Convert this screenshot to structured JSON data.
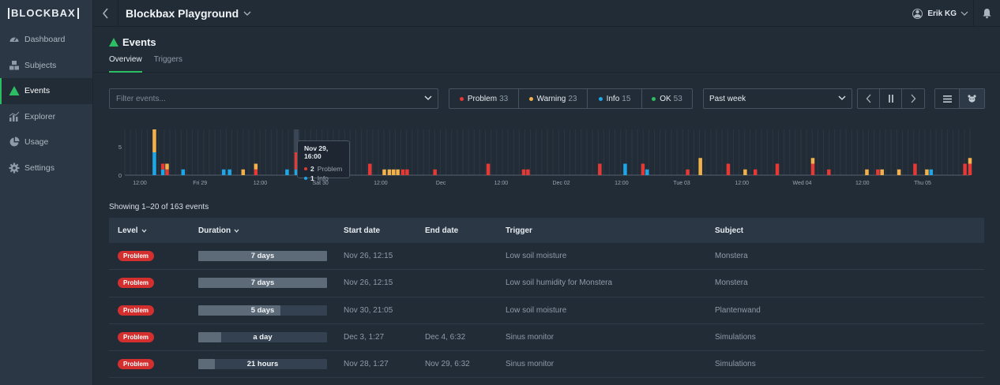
{
  "app": {
    "logo_text": "BLOCKBAX"
  },
  "sidebar": {
    "items": [
      {
        "label": "Dashboard",
        "icon": "gauge-icon"
      },
      {
        "label": "Subjects",
        "icon": "cubes-icon"
      },
      {
        "label": "Events",
        "icon": "warning-triangle-icon",
        "active": true
      },
      {
        "label": "Explorer",
        "icon": "bar-chart-icon"
      },
      {
        "label": "Usage",
        "icon": "pie-chart-icon"
      },
      {
        "label": "Settings",
        "icon": "gear-icon"
      }
    ]
  },
  "topbar": {
    "workspace": "Blockbax Playground",
    "user": "Erik KG"
  },
  "page": {
    "title": "Events",
    "tabs": [
      {
        "label": "Overview",
        "active": true
      },
      {
        "label": "Triggers",
        "active": false
      }
    ]
  },
  "filters": {
    "search_placeholder": "Filter events...",
    "levels": [
      {
        "label": "Problem",
        "count": "33",
        "color": "#e53935"
      },
      {
        "label": "Warning",
        "count": "23",
        "color": "#f2b14a"
      },
      {
        "label": "Info",
        "count": "15",
        "color": "#1da7e8"
      },
      {
        "label": "OK",
        "count": "53",
        "color": "#2dbd63"
      }
    ],
    "range": "Past week"
  },
  "chart_data": {
    "type": "bar",
    "stacked": true,
    "yticks": [
      "0",
      "5"
    ],
    "ylim": [
      0,
      8
    ],
    "xticks": [
      "12:00",
      "Fri 29",
      "12:00",
      "Sat 30",
      "12:00",
      "Dec",
      "12:00",
      "Dec 02",
      "12:00",
      "Tue 03",
      "12:00",
      "Wed 04",
      "12:00",
      "Thu 05"
    ],
    "grid": true,
    "bars": [
      {
        "x": 0.035,
        "problem": 0,
        "warning": 4,
        "info": 4
      },
      {
        "x": 0.045,
        "problem": 1,
        "warning": 0,
        "info": 1
      },
      {
        "x": 0.05,
        "problem": 1,
        "warning": 1,
        "info": 0
      },
      {
        "x": 0.069,
        "problem": 0,
        "warning": 0,
        "info": 1
      },
      {
        "x": 0.117,
        "problem": 0,
        "warning": 0,
        "info": 1
      },
      {
        "x": 0.124,
        "problem": 0,
        "warning": 0,
        "info": 1
      },
      {
        "x": 0.14,
        "problem": 0,
        "warning": 1,
        "info": 0
      },
      {
        "x": 0.155,
        "problem": 1,
        "warning": 1,
        "info": 0
      },
      {
        "x": 0.192,
        "problem": 0,
        "warning": 0,
        "info": 1
      },
      {
        "x": 0.203,
        "problem": 3,
        "warning": 0,
        "info": 1
      },
      {
        "x": 0.223,
        "problem": 1,
        "warning": 0,
        "info": 1
      },
      {
        "x": 0.29,
        "problem": 2,
        "warning": 0,
        "info": 0
      },
      {
        "x": 0.307,
        "problem": 0,
        "warning": 1,
        "info": 0
      },
      {
        "x": 0.313,
        "problem": 0,
        "warning": 1,
        "info": 0
      },
      {
        "x": 0.318,
        "problem": 0,
        "warning": 1,
        "info": 0
      },
      {
        "x": 0.323,
        "problem": 0,
        "warning": 1,
        "info": 0
      },
      {
        "x": 0.329,
        "problem": 1,
        "warning": 0,
        "info": 0
      },
      {
        "x": 0.334,
        "problem": 1,
        "warning": 0,
        "info": 0
      },
      {
        "x": 0.367,
        "problem": 1,
        "warning": 0,
        "info": 0
      },
      {
        "x": 0.43,
        "problem": 2,
        "warning": 0,
        "info": 0
      },
      {
        "x": 0.472,
        "problem": 1,
        "warning": 0,
        "info": 0
      },
      {
        "x": 0.477,
        "problem": 1,
        "warning": 0,
        "info": 0
      },
      {
        "x": 0.562,
        "problem": 2,
        "warning": 0,
        "info": 0
      },
      {
        "x": 0.592,
        "problem": 0,
        "warning": 0,
        "info": 2
      },
      {
        "x": 0.613,
        "problem": 2,
        "warning": 0,
        "info": 0
      },
      {
        "x": 0.618,
        "problem": 0,
        "warning": 0,
        "info": 1
      },
      {
        "x": 0.666,
        "problem": 1,
        "warning": 0,
        "info": 0
      },
      {
        "x": 0.681,
        "problem": 0,
        "warning": 3,
        "info": 0
      },
      {
        "x": 0.714,
        "problem": 2,
        "warning": 0,
        "info": 0
      },
      {
        "x": 0.734,
        "problem": 0,
        "warning": 1,
        "info": 0
      },
      {
        "x": 0.746,
        "problem": 1,
        "warning": 0,
        "info": 0
      },
      {
        "x": 0.772,
        "problem": 2,
        "warning": 0,
        "info": 0
      },
      {
        "x": 0.814,
        "problem": 2,
        "warning": 1,
        "info": 0
      },
      {
        "x": 0.833,
        "problem": 1,
        "warning": 0,
        "info": 0
      },
      {
        "x": 0.878,
        "problem": 0,
        "warning": 1,
        "info": 0
      },
      {
        "x": 0.891,
        "problem": 1,
        "warning": 0,
        "info": 0
      },
      {
        "x": 0.896,
        "problem": 0,
        "warning": 1,
        "info": 0
      },
      {
        "x": 0.916,
        "problem": 0,
        "warning": 1,
        "info": 0
      },
      {
        "x": 0.935,
        "problem": 2,
        "warning": 0,
        "info": 0
      },
      {
        "x": 0.949,
        "problem": 0,
        "warning": 1,
        "info": 0
      },
      {
        "x": 0.954,
        "problem": 0,
        "warning": 0,
        "info": 1
      },
      {
        "x": 0.994,
        "problem": 2,
        "warning": 0,
        "info": 0
      },
      {
        "x": 1.0,
        "problem": 2,
        "warning": 1,
        "info": 0
      }
    ]
  },
  "tooltip": {
    "title": "Nov 29, 16:00",
    "rows": [
      {
        "count": "2",
        "label": "Problem",
        "color": "#e53935"
      },
      {
        "count": "1",
        "label": "Info",
        "color": "#1da7e8"
      }
    ]
  },
  "summary": "Showing 1–20 of 163 events",
  "table": {
    "columns": [
      "Level",
      "Duration",
      "Start date",
      "End date",
      "Trigger",
      "Subject"
    ],
    "rows": [
      {
        "level": "Problem",
        "duration": "7 days",
        "fill": 1.0,
        "start": "Nov 26, 12:15",
        "end": "",
        "trigger": "Low soil moisture",
        "subject": "Monstera"
      },
      {
        "level": "Problem",
        "duration": "7 days",
        "fill": 1.0,
        "start": "Nov 26, 12:15",
        "end": "",
        "trigger": "Low soil humidity for Monstera",
        "subject": "Monstera"
      },
      {
        "level": "Problem",
        "duration": "5 days",
        "fill": 0.64,
        "start": "Nov 30, 21:05",
        "end": "",
        "trigger": "Low soil moisture",
        "subject": "Plantenwand"
      },
      {
        "level": "Problem",
        "duration": "a day",
        "fill": 0.18,
        "start": "Dec 3, 1:27",
        "end": "Dec 4, 6:32",
        "trigger": "Sinus monitor",
        "subject": "Simulations"
      },
      {
        "level": "Problem",
        "duration": "21 hours",
        "fill": 0.13,
        "start": "Nov 28, 1:27",
        "end": "Nov 29, 6:32",
        "trigger": "Sinus monitor",
        "subject": "Simulations"
      }
    ]
  }
}
